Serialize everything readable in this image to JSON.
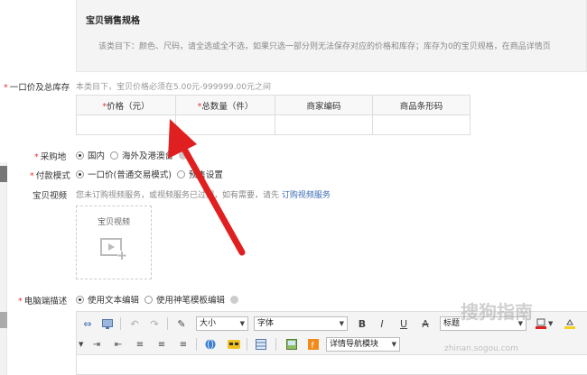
{
  "specs": {
    "title": "宝贝销售规格",
    "description": "该类目下：颜色、尺码，请全选或全不选，如果只选一部分则无法保存对应的价格和库存；库存为0的宝贝规格，在商品详情页"
  },
  "price_stock": {
    "label": "一口价及总库存",
    "hint": "本类目下，宝贝价格必须在5.00元-999999.00元之间",
    "columns": [
      {
        "label": "价格（元）",
        "required": true
      },
      {
        "label": "总数量（件）",
        "required": true
      },
      {
        "label": "商家编码",
        "required": false
      },
      {
        "label": "商品条形码",
        "required": false
      }
    ],
    "required_mark": "*"
  },
  "purchase_location": {
    "label": "采购地",
    "options": [
      "国内",
      "海外及港澳台"
    ],
    "selected": "国内"
  },
  "payment_mode": {
    "label": "付款模式",
    "options": [
      "一口价(普通交易模式)",
      "预售设置"
    ],
    "selected": "一口价(普通交易模式)"
  },
  "video": {
    "label": "宝贝视频",
    "notice_prefix": "您未订购视频服务，或视频服务已过期，如有需要，请先",
    "notice_link": "订购视频服务",
    "box_title": "宝贝视频"
  },
  "pc_description": {
    "label": "电脑端描述",
    "options": [
      "使用文本编辑",
      "使用神笔模板编辑"
    ],
    "selected": "使用文本编辑"
  },
  "editor_toolbar": {
    "font_size": "大小",
    "font_family": "字体",
    "bold": "B",
    "italic": "I",
    "underline": "U",
    "strike": "A",
    "heading": "标题",
    "detail_nav": "详情导航模块"
  },
  "watermark": {
    "text": "搜狗指南",
    "url": "zhinan.sogou.com"
  },
  "colors": {
    "required": "#e4393c",
    "link": "#3b6bb5",
    "arrow": "#e02020"
  }
}
